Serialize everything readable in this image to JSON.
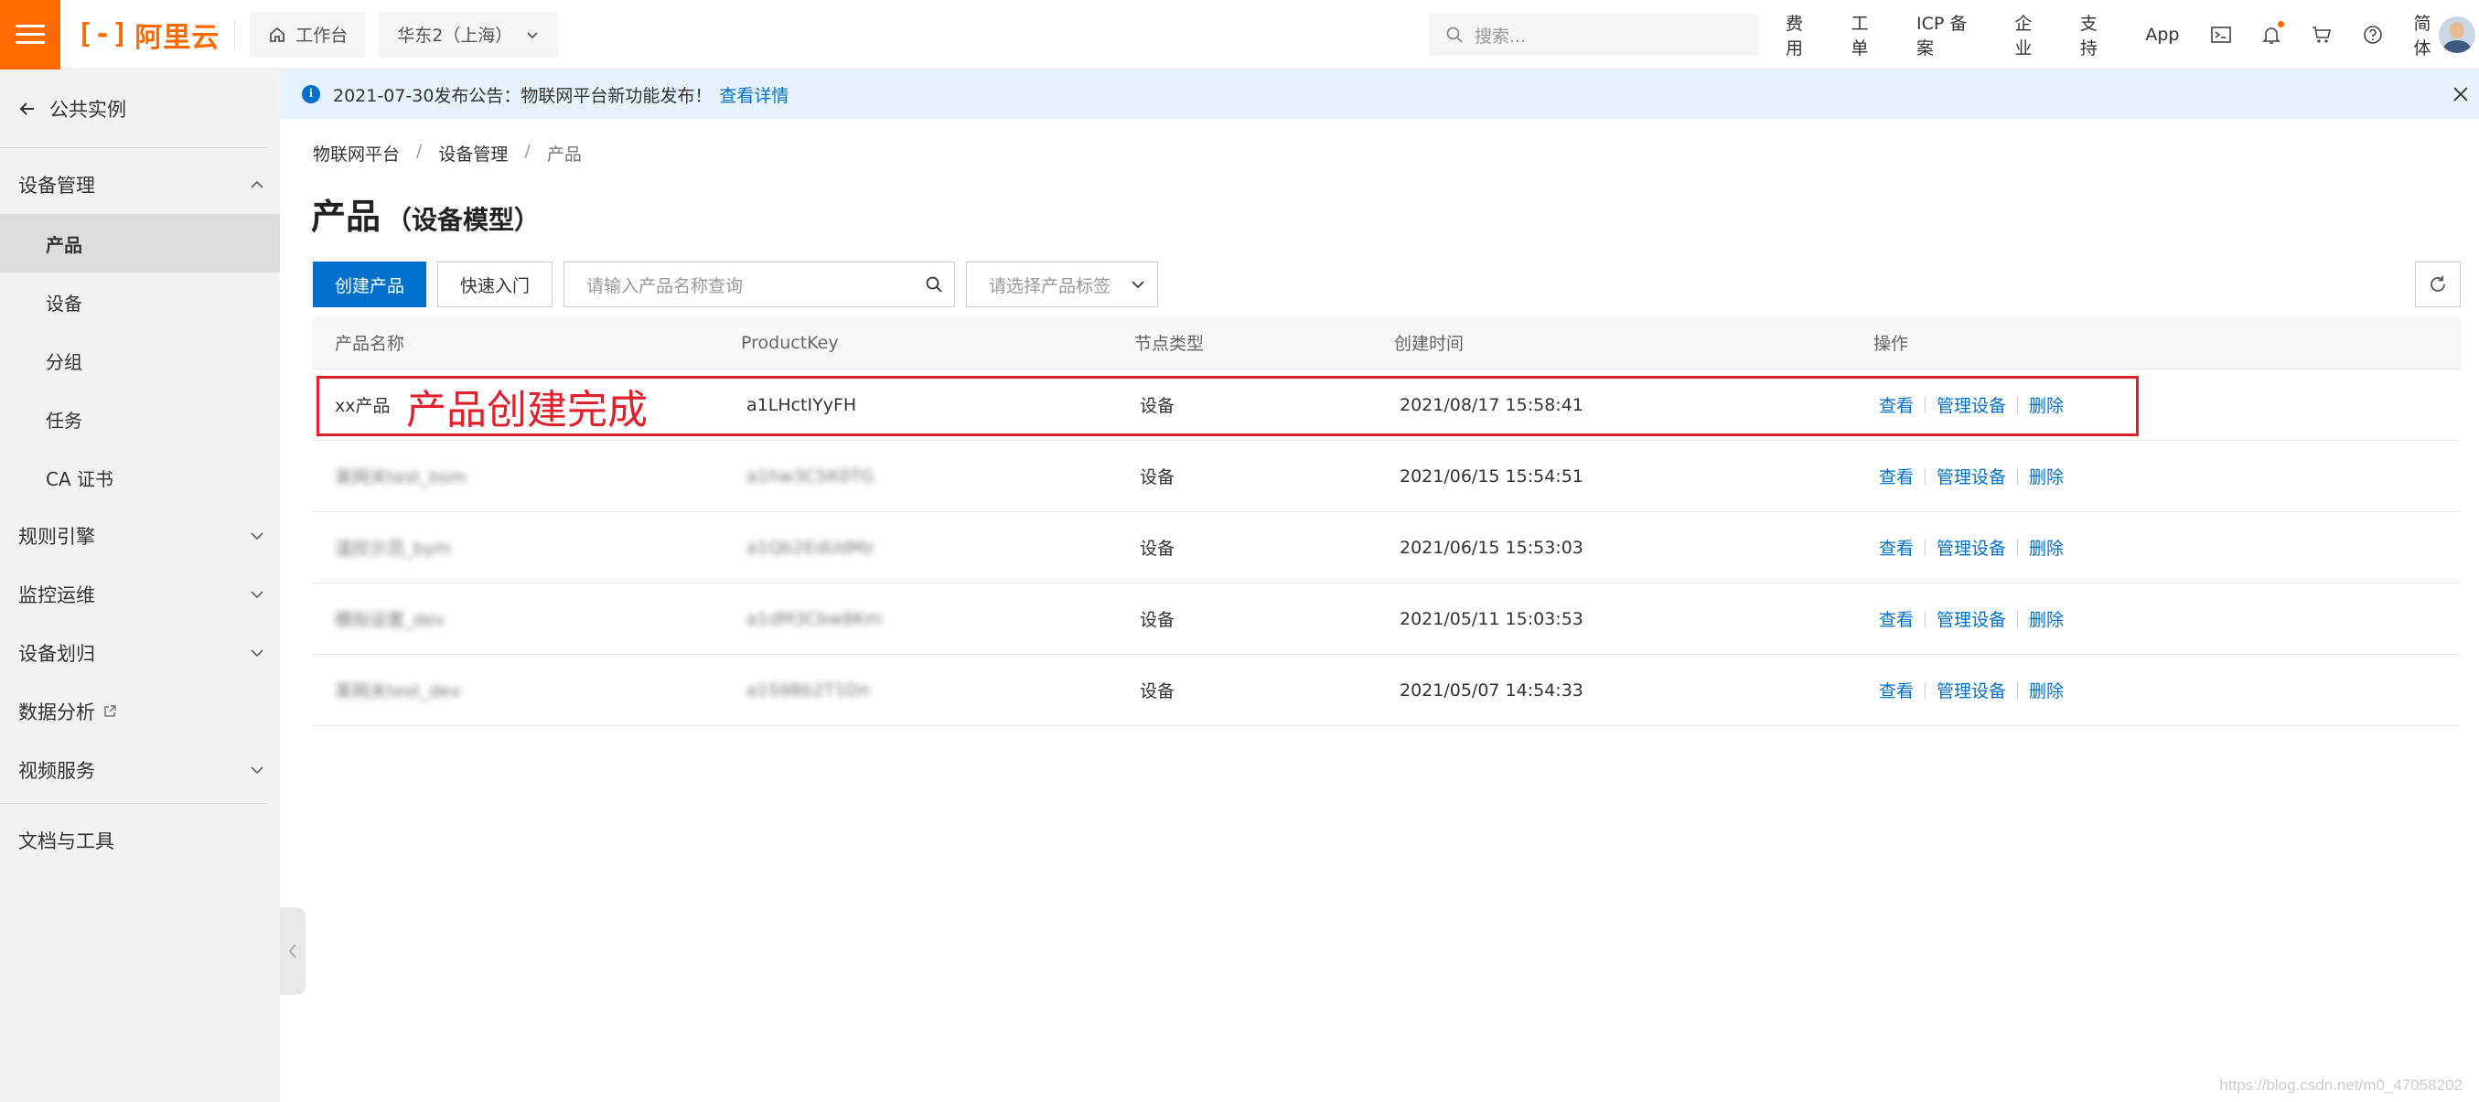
{
  "topbar": {
    "brand": "阿里云",
    "workbench": "工作台",
    "region": "华东2（上海）",
    "search_placeholder": "搜索...",
    "links": [
      "费用",
      "工单",
      "ICP 备案",
      "企业",
      "支持",
      "App"
    ],
    "lang": "简体",
    "accent": "#ff6a00"
  },
  "sidebar": {
    "back_label": "公共实例",
    "groups": [
      {
        "label": "设备管理",
        "items": [
          "产品",
          "设备",
          "分组",
          "任务",
          "CA 证书"
        ]
      },
      {
        "label": "规则引擎"
      },
      {
        "label": "监控运维"
      },
      {
        "label": "设备划归"
      },
      {
        "label": "数据分析"
      },
      {
        "label": "视频服务"
      }
    ],
    "docs": "文档与工具"
  },
  "notice": {
    "text": "2021-07-30发布公告：物联网平台新功能发布！",
    "link": "查看详情"
  },
  "breadcrumb": [
    "物联网平台",
    "设备管理",
    "产品"
  ],
  "page": {
    "title": "产品",
    "subtitle": "（设备模型）"
  },
  "toolbar": {
    "create": "创建产品",
    "quickstart": "快速入门",
    "search_placeholder": "请输入产品名称查询",
    "tag_placeholder": "请选择产品标签"
  },
  "table": {
    "columns": [
      "产品名称",
      "ProductKey",
      "节点类型",
      "创建时间",
      "操作"
    ],
    "rows": [
      {
        "name": "xx产品",
        "key": "a1LHctIYyFH",
        "node": "设备",
        "time": "2021/08/17 15:58:41"
      },
      {
        "name": "某网关test_bsm",
        "key": "a1hw3C5K0TG",
        "node": "设备",
        "time": "2021/06/15 15:54:51"
      },
      {
        "name": "温控示范_bym",
        "key": "a1Qb2EdUdMz",
        "node": "设备",
        "time": "2021/06/15 15:53:03"
      },
      {
        "name": "模拟设置_dev",
        "key": "a1dM3Cbw8Km",
        "node": "设备",
        "time": "2021/05/11 15:03:53"
      },
      {
        "name": "某网关test_dev",
        "key": "a1S9Bb2T1Dn",
        "node": "设备",
        "time": "2021/05/07 14:54:33"
      }
    ],
    "ops": [
      "查看",
      "管理设备",
      "删除"
    ]
  },
  "annotation": "产品创建完成",
  "watermark": "https://blog.csdn.net/m0_47058202"
}
